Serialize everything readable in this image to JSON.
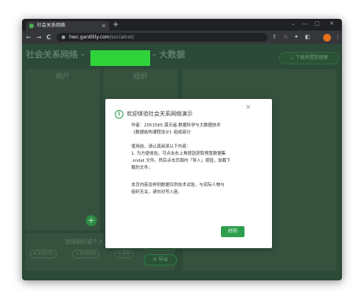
{
  "browser": {
    "tab_title": "社会关系网络",
    "tab_close": "×",
    "new_tab": "+",
    "url_domain": "hwc.gardilily.com",
    "url_path": "/socialnet/",
    "nav_back": "←",
    "nav_forward": "→",
    "nav_reload": "C",
    "lock_icon": "🔒",
    "win_min": "—",
    "win_max": "□",
    "win_close": "✕",
    "win_chevron": "⌄",
    "toolbar_icons": [
      "⇪",
      "☆",
      "✦",
      "◧",
      "⋮"
    ]
  },
  "page": {
    "title_prefix": "社会关系网络 - ",
    "title_suffix": "- 大数据",
    "download_button": "⊥ 下载预置数据集",
    "panels": {
      "users": "用户",
      "orgs": "组织"
    },
    "add_button": "+",
    "selector": {
      "title": "选择组织或个人",
      "chips": [
        "⊗ 关系分析",
        "✕ 取消选择",
        "⊘ 删除"
      ],
      "import_button": "⊡ 导入",
      "export_button": "⊡ 导出"
    }
  },
  "modal": {
    "title": "欢迎体验社会关系网络演示",
    "close": "×",
    "info_icon": "i",
    "author_line1": "作者：2051565  龚天遥  数据科学与大数据技术",
    "author_line2": "《数据结构课程设计》组成部分",
    "usage_heading": "使用前，请认真阅读以下内容：",
    "usage_line1": "1. 为方便体验，可点击右上角按钮获取预置数据集",
    "usage_line2": ".sndat 文件。然后点击页面内「导入」按钮，加载下",
    "usage_line3": "载的文件。",
    "disclaimer_line1": "本页内容及样例数据仅供技术试验，与实际人物与",
    "disclaimer_line2": "组织无关，请勿对号入座。",
    "ok_button": "好的"
  },
  "colors": {
    "accent": "#2e9e4f",
    "redaction": "#2ed33a",
    "page_bg": "#2c4a37"
  }
}
